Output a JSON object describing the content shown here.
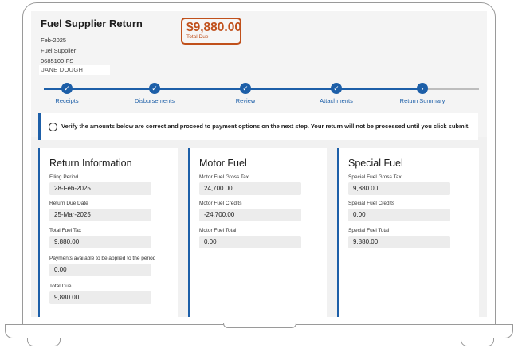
{
  "header": {
    "title": "Fuel Supplier Return",
    "period": "Feb-2025",
    "supplier_type": "Fuel Supplier",
    "account_id": "0685100-FS",
    "name": "JANE DOUGH",
    "total_due_amount": "$9,880.00",
    "total_due_label": "Total Due"
  },
  "steps": [
    {
      "label": "Receipts",
      "icon": "check-icon",
      "state": "complete"
    },
    {
      "label": "Disbursements",
      "icon": "check-icon",
      "state": "complete"
    },
    {
      "label": "Review",
      "icon": "check-icon",
      "state": "complete"
    },
    {
      "label": "Attachments",
      "icon": "check-icon",
      "state": "complete"
    },
    {
      "label": "Return Summary",
      "icon": "chevron-right-icon",
      "state": "current"
    }
  ],
  "alert": {
    "icon": "info-icon",
    "text": "Verify the amounts below are correct and proceed to payment options on the next step. Your return will not be processed until you click submit."
  },
  "return_info": {
    "title": "Return Information",
    "filing_period_label": "Filing Period",
    "filing_period": "28-Feb-2025",
    "due_date_label": "Return Due Date",
    "due_date": "25-Mar-2025",
    "total_fuel_tax_label": "Total Fuel Tax",
    "total_fuel_tax": "9,880.00",
    "payments_label": "Payments available to be applied to the period",
    "payments": "0.00",
    "total_due_label": "Total Due",
    "total_due": "9,880.00"
  },
  "motor_fuel": {
    "title": "Motor Fuel",
    "gross_tax_label": "Motor Fuel Gross Tax",
    "gross_tax": "24,700.00",
    "credits_label": "Motor Fuel Credits",
    "credits": "-24,700.00",
    "total_label": "Motor Fuel Total",
    "total": "0.00"
  },
  "special_fuel": {
    "title": "Special Fuel",
    "gross_tax_label": "Special Fuel Gross Tax",
    "gross_tax": "9,880.00",
    "credits_label": "Special Fuel Credits",
    "credits": "0.00",
    "total_label": "Special Fuel Total",
    "total": "9,880.00"
  },
  "colors": {
    "accent": "#1d5fa8",
    "due_highlight": "#c0501b"
  }
}
